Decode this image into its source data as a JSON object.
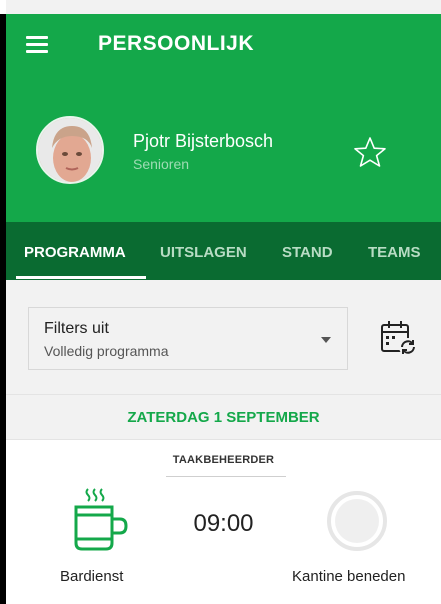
{
  "colors": {
    "primary_green": "#14a84a",
    "dark_green": "#0a6b31",
    "background": "#f2f2f2",
    "card": "#ffffff"
  },
  "header": {
    "menu_icon": "hamburger-menu-icon",
    "title": "PERSOONLIJK"
  },
  "profile": {
    "name": "Pjotr Bijsterbosch",
    "team": "Senioren",
    "favorite_icon": "star-outline-icon"
  },
  "tabs": [
    {
      "label": "PROGRAMMA",
      "active": true
    },
    {
      "label": "UITSLAGEN",
      "active": false
    },
    {
      "label": "STAND",
      "active": false
    },
    {
      "label": "TEAMS",
      "active": false
    }
  ],
  "filter": {
    "title": "Filters uit",
    "subtitle": "Volledig programma",
    "calendar_icon": "calendar-sync-icon"
  },
  "date_header": "ZATERDAG 1 SEPTEMBER",
  "task": {
    "role": "TAAKBEHEERDER",
    "time": "09:00",
    "duty": "Bardienst",
    "location": "Kantine beneden",
    "duty_icon": "coffee-cup-icon",
    "status_icon": "status-circle-icon"
  }
}
